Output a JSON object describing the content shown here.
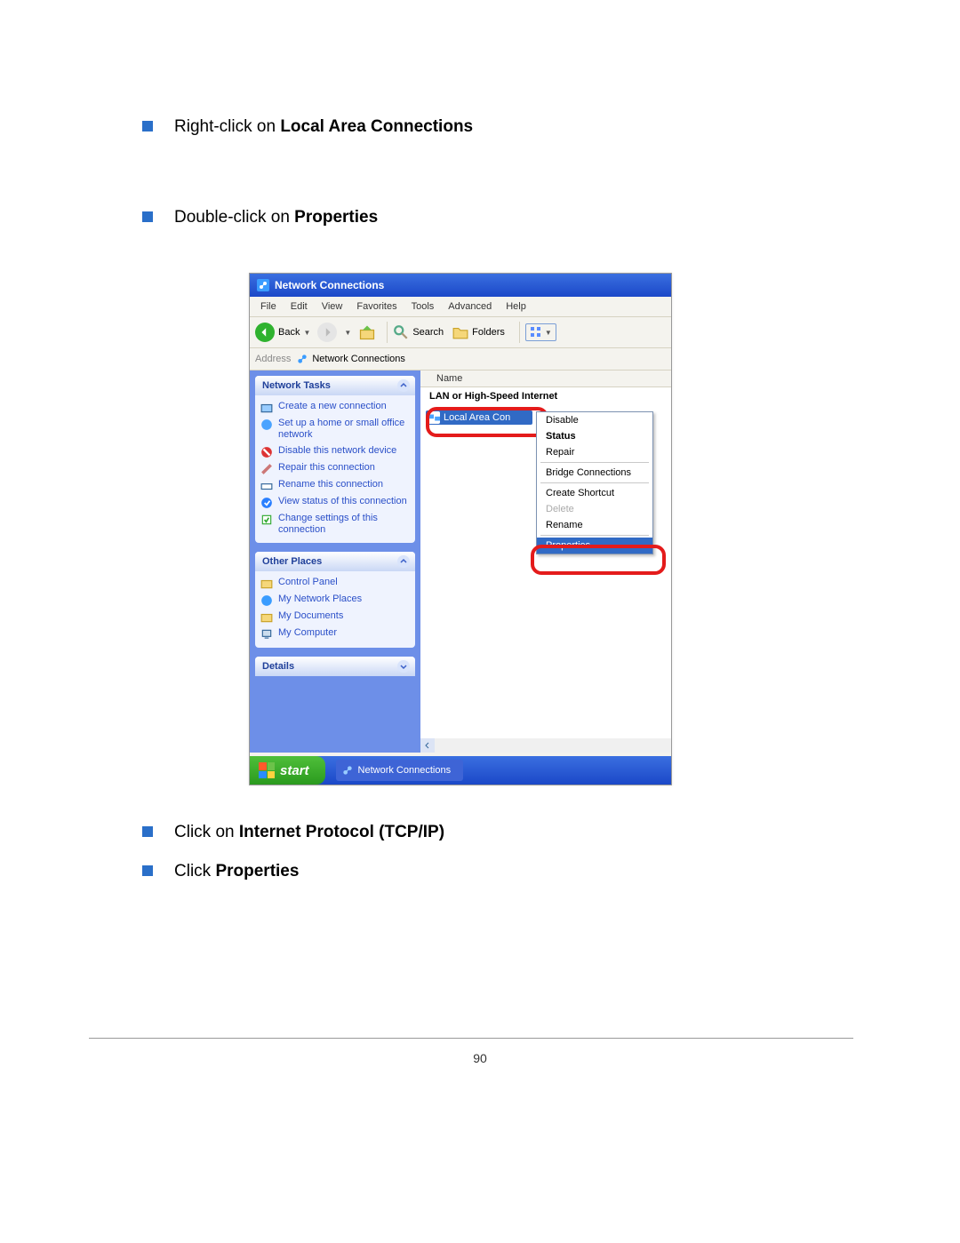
{
  "instructions": {
    "step1_prefix": "Right-click on ",
    "step1_bold": "Local Area Connections",
    "step2_prefix": "Double-click on ",
    "step2_bold": "Properties",
    "step3_prefix": "Click on ",
    "step3_bold": "Internet Protocol (TCP/IP)",
    "step4_prefix": "Click ",
    "step4_bold": "Properties"
  },
  "window": {
    "title": "Network Connections",
    "menus": [
      "File",
      "Edit",
      "View",
      "Favorites",
      "Tools",
      "Advanced",
      "Help"
    ],
    "toolbar": {
      "back": "Back",
      "search": "Search",
      "folders": "Folders"
    },
    "address_label": "Address",
    "address_value": "Network Connections"
  },
  "sidebar": {
    "tasks_header": "Network Tasks",
    "tasks": [
      "Create a new connection",
      "Set up a home or small office network",
      "Disable this network device",
      "Repair this connection",
      "Rename this connection",
      "View status of this connection",
      "Change settings of this connection"
    ],
    "places_header": "Other Places",
    "places": [
      "Control Panel",
      "My Network Places",
      "My Documents",
      "My Computer"
    ],
    "details_header": "Details"
  },
  "content": {
    "column_header": "Name",
    "section": "LAN or High-Speed Internet",
    "item": "Local Area Con"
  },
  "context_menu": {
    "items": [
      "Disable",
      "Status",
      "Repair",
      "Bridge Connections",
      "Create Shortcut",
      "Delete",
      "Rename",
      "Properties"
    ],
    "disabled": [
      "Delete"
    ],
    "selected": "Properties"
  },
  "taskbar": {
    "start": "start",
    "app": "Network Connections"
  },
  "page_number": "90"
}
